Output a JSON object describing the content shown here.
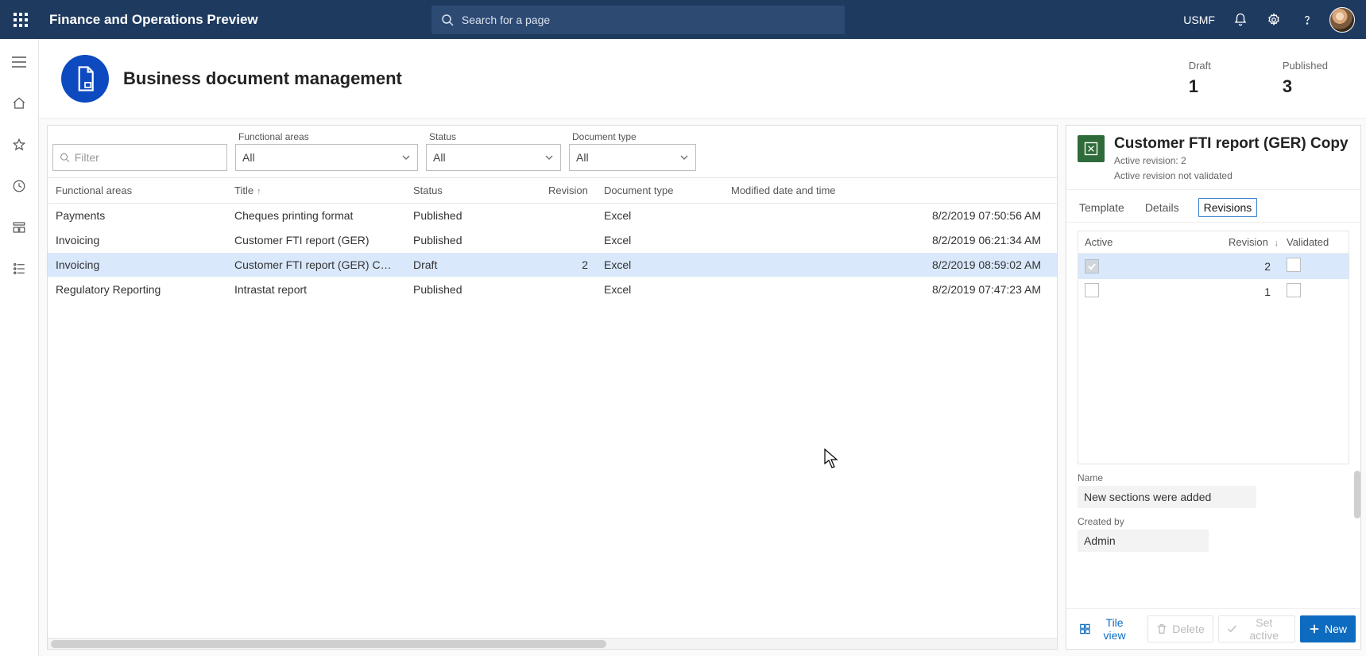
{
  "topbar": {
    "app_title": "Finance and Operations Preview",
    "search_placeholder": "Search for a page",
    "legal_entity": "USMF"
  },
  "page": {
    "title": "Business document management"
  },
  "stats": {
    "draft_label": "Draft",
    "draft_value": "1",
    "published_label": "Published",
    "published_value": "3"
  },
  "filters": {
    "filter_placeholder": "Filter",
    "functional_areas_label": "Functional areas",
    "functional_areas_value": "All",
    "status_label": "Status",
    "status_value": "All",
    "doctype_label": "Document type",
    "doctype_value": "All"
  },
  "columns": {
    "functional_areas": "Functional areas",
    "title": "Title",
    "status": "Status",
    "revision": "Revision",
    "doctype": "Document type",
    "modified": "Modified date and time"
  },
  "rows": [
    {
      "fa": "Payments",
      "title": "Cheques printing format",
      "status": "Published",
      "rev": "",
      "doctype": "Excel",
      "mod": "8/2/2019 07:50:56 AM",
      "selected": false
    },
    {
      "fa": "Invoicing",
      "title": "Customer FTI report (GER)",
      "status": "Published",
      "rev": "",
      "doctype": "Excel",
      "mod": "8/2/2019 06:21:34 AM",
      "selected": false
    },
    {
      "fa": "Invoicing",
      "title": "Customer FTI report (GER) Copy",
      "status": "Draft",
      "rev": "2",
      "doctype": "Excel",
      "mod": "8/2/2019 08:59:02 AM",
      "selected": true
    },
    {
      "fa": "Regulatory Reporting",
      "title": "Intrastat report",
      "status": "Published",
      "rev": "",
      "doctype": "Excel",
      "mod": "8/2/2019 07:47:23 AM",
      "selected": false
    }
  ],
  "detail": {
    "title": "Customer FTI report (GER) Copy",
    "sub1": "Active revision: 2",
    "sub2": "Active revision not validated",
    "tabs": {
      "template": "Template",
      "details": "Details",
      "revisions": "Revisions"
    },
    "rev_cols": {
      "active": "Active",
      "revision": "Revision",
      "validated": "Validated"
    },
    "revisions": [
      {
        "active": true,
        "rev": "2",
        "validated": false,
        "selected": true
      },
      {
        "active": false,
        "rev": "1",
        "validated": false,
        "selected": false
      }
    ],
    "name_label": "Name",
    "name_value": "New sections were added",
    "createdby_label": "Created by",
    "createdby_value": "Admin"
  },
  "actions": {
    "tile_view": "Tile view",
    "delete": "Delete",
    "set_active": "Set active",
    "new": "New"
  }
}
